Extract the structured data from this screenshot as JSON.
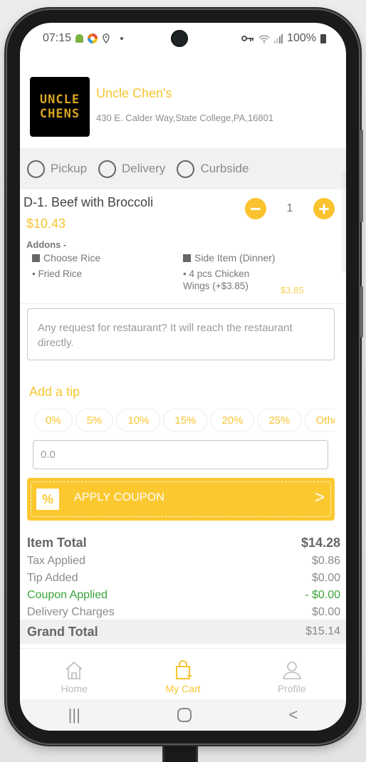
{
  "status_bar": {
    "time": "07:15",
    "battery": "100%",
    "icons": [
      "android-icon",
      "app-icon",
      "location-icon",
      "dot-icon",
      "vpn-key-icon",
      "wifi-icon",
      "signal-icon",
      "battery-icon"
    ]
  },
  "restaurant": {
    "logo_line1": "UNCLE",
    "logo_line2": "CHENS",
    "name": "Uncle Chen's",
    "address": "430 E. Calder Way,State College,PA,16801"
  },
  "order_types": [
    {
      "label": "Pickup",
      "selected": false
    },
    {
      "label": "Delivery",
      "selected": false
    },
    {
      "label": "Curbside",
      "selected": false
    }
  ],
  "cart_item": {
    "name": "D-1. Beef with Broccoli",
    "price": "$10.43",
    "quantity": "1",
    "minus_icon": "minus-icon",
    "plus_icon": "plus-icon",
    "addons_title": "Addons -",
    "addons": [
      {
        "group": "Choose Rice",
        "option": "• Fried Rice",
        "extra": ""
      },
      {
        "group": "Side Item (Dinner)",
        "option": "• 4 pcs Chicken Wings (+$3.85)",
        "extra": "$3.85"
      }
    ]
  },
  "request": {
    "placeholder": "Any request for restaurant? It will reach the restaurant directly."
  },
  "tip": {
    "title": "Add a tip",
    "options": [
      "0%",
      "5%",
      "10%",
      "15%",
      "20%",
      "25%",
      "Other"
    ],
    "input_value": "0.0"
  },
  "coupon": {
    "label": "APPLY COUPON",
    "chevron": ">"
  },
  "totals": {
    "item_total_label": "Item Total",
    "item_total": "$14.28",
    "tax_label": "Tax Applied",
    "tax": "$0.86",
    "tip_label": "Tip Added",
    "tip": "$0.00",
    "coupon_label": "Coupon Applied",
    "coupon": "- $0.00",
    "delivery_label": "Delivery Charges",
    "delivery": "$0.00",
    "grand_label": "Grand Total",
    "grand": "$15.14"
  },
  "bottom_nav": [
    {
      "label": "Home",
      "icon": "home-icon",
      "active": false
    },
    {
      "label": "My Cart",
      "icon": "shopping-bag-icon",
      "active": true
    },
    {
      "label": "Profile",
      "icon": "profile-icon",
      "active": false
    }
  ],
  "system_nav": {
    "recents": "|||",
    "home": "○",
    "back": "<"
  },
  "colors": {
    "accent": "#FCC830",
    "coupon_green": "#3AA33A",
    "text_muted": "#8A8A8A"
  }
}
